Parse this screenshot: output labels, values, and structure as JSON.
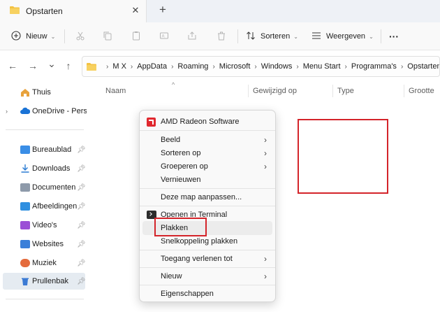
{
  "tab": {
    "title": "Opstarten",
    "close_icon": "✕",
    "new_tab_icon": "+"
  },
  "toolbar": {
    "new": "Nieuw",
    "sort": "Sorteren",
    "view": "Weergeven",
    "more": "···"
  },
  "nav": {
    "back": "←",
    "forward": "→",
    "recent": "⌄",
    "up": "↑"
  },
  "breadcrumb": [
    "M X",
    "AppData",
    "Roaming",
    "Microsoft",
    "Windows",
    "Menu Start",
    "Programma's",
    "Opstarten"
  ],
  "sidebar": {
    "home": "Thuis",
    "onedrive": "OneDrive - Persoonlijk",
    "items": [
      {
        "label": "Bureaublad",
        "icon": "desktop-icon",
        "color": "#3a8ee6"
      },
      {
        "label": "Downloads",
        "icon": "download-icon",
        "color": "#2b7cd3"
      },
      {
        "label": "Documenten",
        "icon": "documents-icon",
        "color": "#8e9aaa"
      },
      {
        "label": "Afbeeldingen",
        "icon": "pictures-icon",
        "color": "#2f8fe0"
      },
      {
        "label": "Video's",
        "icon": "videos-icon",
        "color": "#9b4fd6"
      },
      {
        "label": "Websites",
        "icon": "websites-icon",
        "color": "#3a7fd9"
      },
      {
        "label": "Muziek",
        "icon": "music-icon",
        "color": "#e46b3c"
      },
      {
        "label": "Prullenbak",
        "icon": "recycle-bin-icon",
        "color": "#3c7bd4"
      }
    ]
  },
  "columns": [
    "Naam",
    "Gewijzigd op",
    "Type",
    "Grootte"
  ],
  "context_menu": {
    "amd": "AMD Radeon Software",
    "view": "Beeld",
    "sort_by": "Sorteren op",
    "group_by": "Groeperen op",
    "refresh": "Vernieuwen",
    "customize": "Deze map aanpassen...",
    "terminal": "Openen in Terminal",
    "paste": "Plakken",
    "paste_shortcut": "Snelkoppeling plakken",
    "grant_access": "Toegang verlenen tot",
    "new": "Nieuw",
    "properties": "Eigenschappen",
    "submenu_arrow": "›"
  },
  "colors": {
    "folder": "#f3c241",
    "highlight": "#d4242a",
    "accent": "#0067c0"
  }
}
